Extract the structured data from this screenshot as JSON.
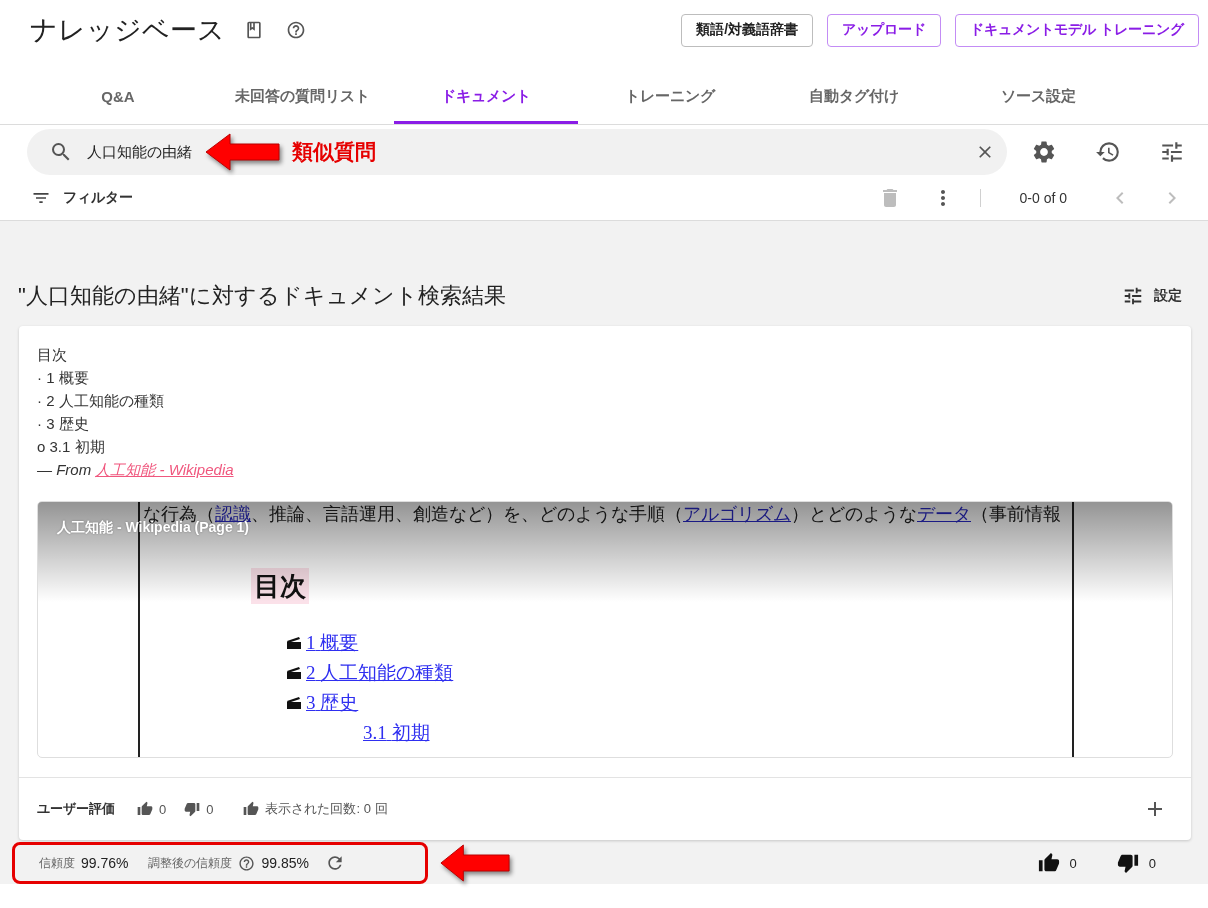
{
  "header": {
    "title": "ナレッジベース",
    "buttons": [
      {
        "label": "類語/対義語辞書",
        "kind": "outlined"
      },
      {
        "label": "アップロード",
        "kind": "primary"
      },
      {
        "label": "ドキュメントモデル トレーニング",
        "kind": "primary"
      }
    ]
  },
  "tabs": [
    {
      "label": "Q&A",
      "selected": false
    },
    {
      "label": "未回答の質問リスト",
      "selected": false
    },
    {
      "label": "ドキュメント",
      "selected": true
    },
    {
      "label": "トレーニング",
      "selected": false
    },
    {
      "label": "自動タグ付け",
      "selected": false
    },
    {
      "label": "ソース設定",
      "selected": false
    }
  ],
  "search": {
    "value": "人口知能の由緒",
    "callout": "類似質問"
  },
  "toolbar": {
    "filter_label": "フィルター",
    "delete_disabled": true,
    "range": "0-0 of 0",
    "prev_disabled": true,
    "next_disabled": true
  },
  "results": {
    "title": "\"人口知能の由緒\"に対するドキュメント検索結果",
    "settings_label": "設定",
    "card": {
      "lines": [
        "目次",
        "· 1 概要",
        "· 2 人工知能の種類",
        "· 3 歴史",
        "o 3.1 初期"
      ],
      "source": {
        "prefix": "— From",
        "link": "人工知能 - Wikipedia"
      },
      "preview": {
        "caption": "人工知能 - Wikipedia (Page 1)",
        "top_line": [
          {
            "text": "な行為（",
            "link": false
          },
          {
            "text": "認識",
            "link": true
          },
          {
            "text": "、推論、言語運用、創造など）を、どのような手順（",
            "link": false
          },
          {
            "text": "アルゴリズム",
            "link": true
          },
          {
            "text": "）とどのような",
            "link": false
          },
          {
            "text": "データ",
            "link": true
          },
          {
            "text": "（事前情報",
            "link": false
          }
        ],
        "heading": "目次",
        "toc": [
          {
            "number": "1",
            "title": "概要"
          },
          {
            "number": "2",
            "title": "人工知能の種類"
          },
          {
            "number": "3",
            "title": "歴史",
            "children": [
              {
                "number": "3.1",
                "title": "初期"
              }
            ]
          }
        ]
      },
      "rating": {
        "label": "ユーザー評価",
        "likes": "0",
        "dislikes": "0",
        "views": "表示された回数: 0 回"
      }
    },
    "confidence": {
      "label": "信頼度",
      "value": "99.76%",
      "adjusted_label": "調整後の信頼度",
      "adjusted_value": "99.85%",
      "highlighted": true
    },
    "votes": {
      "likes": "0",
      "dislikes": "0"
    }
  }
}
